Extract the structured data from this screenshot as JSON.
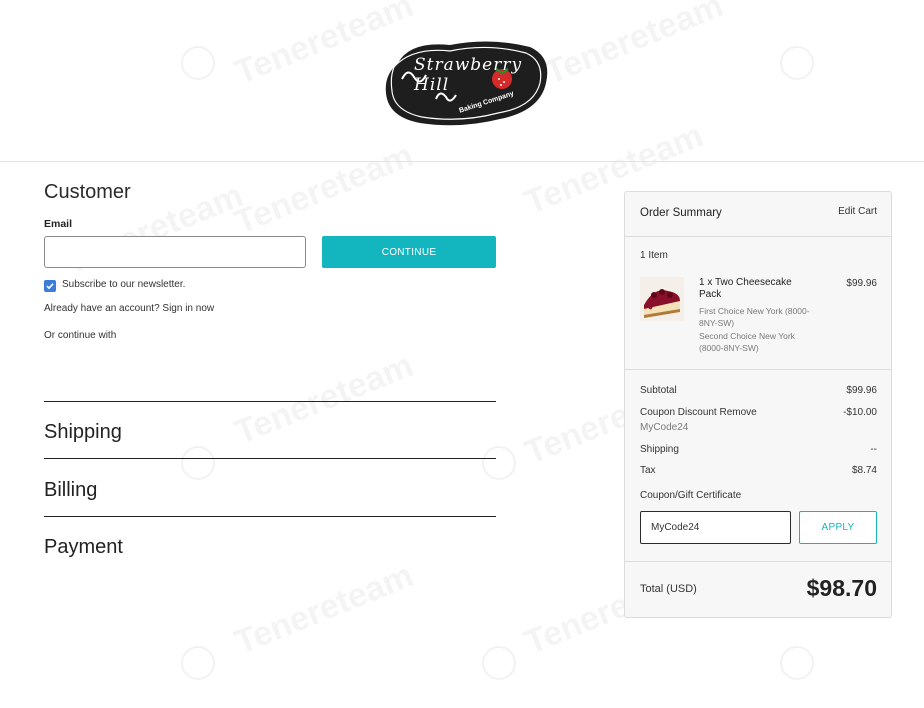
{
  "brand": {
    "logo_text": "Strawberry Hill",
    "logo_subtext": "Baking Company",
    "watermark_text": "Tenereteam"
  },
  "customer": {
    "title": "Customer",
    "email_label": "Email",
    "email_value": "",
    "continue_label": "CONTINUE",
    "subscribe_label": "Subscribe to our newsletter.",
    "subscribe_checked": true,
    "signin_text": "Already have an account? Sign in now",
    "or_continue_text": "Or continue with"
  },
  "steps": {
    "shipping": "Shipping",
    "billing": "Billing",
    "payment": "Payment"
  },
  "summary": {
    "title": "Order Summary",
    "edit_cart": "Edit Cart",
    "item_count": "1 Item",
    "item": {
      "name": "1 x Two Cheesecake Pack",
      "price": "$99.96",
      "options": [
        "First Choice New York (8000-8NY-SW)",
        "Second Choice New York (8000-8NY-SW)"
      ]
    },
    "subtotal_label": "Subtotal",
    "subtotal_value": "$99.96",
    "coupon_label": "Coupon Discount Remove",
    "coupon_code": "MyCode24",
    "coupon_value": "-$10.00",
    "shipping_label": "Shipping",
    "shipping_value": "--",
    "tax_label": "Tax",
    "tax_value": "$8.74",
    "gift_label": "Coupon/Gift Certificate",
    "gift_input_value": "MyCode24",
    "apply_label": "APPLY",
    "total_label": "Total (USD)",
    "total_value": "$98.70"
  },
  "colors": {
    "accent": "#13b5be",
    "checkbox": "#3b7dd8",
    "summary_bg": "#f7f7f8"
  }
}
